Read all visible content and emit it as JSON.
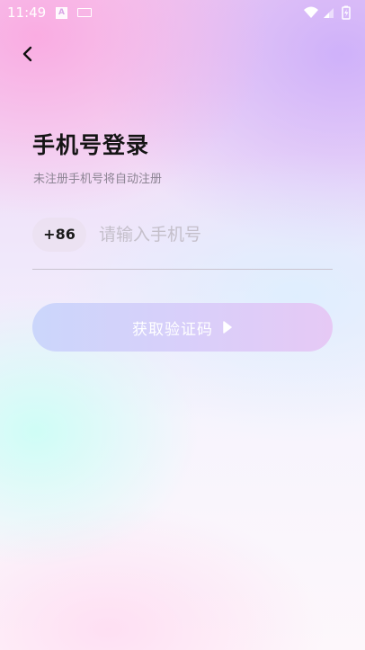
{
  "status_bar": {
    "time": "11:49",
    "app_icon_letter": "A"
  },
  "header": {
    "back_icon": "chevron-left-icon"
  },
  "login": {
    "title": "手机号登录",
    "subtitle": "未注册手机号将自动注册",
    "country_code": "+86",
    "phone_value": "",
    "phone_placeholder": "请输入手机号",
    "get_code_label": "获取验证码",
    "get_code_icon": "play-arrow-icon"
  },
  "colors": {
    "button_gradient_start": "#cbd6fb",
    "button_gradient_end": "#e6c9f5",
    "placeholder": "#c4bfca",
    "title": "#151515",
    "subtitle": "#8c8493"
  }
}
